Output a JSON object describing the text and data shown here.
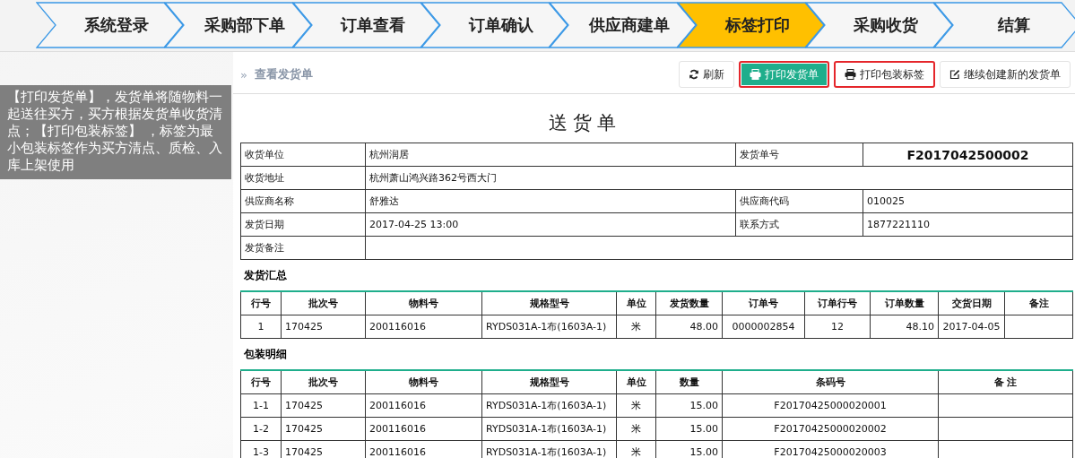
{
  "steps": [
    {
      "label": "系统登录",
      "selected": false
    },
    {
      "label": "采购部下单",
      "selected": false
    },
    {
      "label": "订单查看",
      "selected": false
    },
    {
      "label": "订单确认",
      "selected": false
    },
    {
      "label": "供应商建单",
      "selected": false
    },
    {
      "label": "标签打印",
      "selected": true
    },
    {
      "label": "采购收货",
      "selected": false
    },
    {
      "label": "结算",
      "selected": false
    }
  ],
  "note": "【打印发货单】，发货单将随物料一起送往买方，买方根据发货单收货清点；【打印包装标签】 ，标签为最小包装标签作为买方清点、质检、入库上架使用",
  "breadcrumb": {
    "icon": "»",
    "label": "查看发货单"
  },
  "toolbar": [
    {
      "label": "刷新",
      "kind": "default",
      "highlighted": false
    },
    {
      "label": "打印发货单",
      "kind": "primary",
      "highlighted": true
    },
    {
      "label": "打印包装标签",
      "kind": "default",
      "highlighted": true
    },
    {
      "label": "继续创建新的发货单",
      "kind": "default",
      "highlighted": false
    }
  ],
  "document": {
    "title": "送货单",
    "info_rows": [
      [
        {
          "label": "收货单位",
          "value": "杭州润居",
          "emphasis": false
        },
        {
          "label": "发货单号",
          "value": "F2017042500002",
          "emphasis": true
        }
      ],
      [
        {
          "label": "收货地址",
          "value": "杭州萧山鸿兴路362号西大门",
          "emphasis": false
        }
      ],
      [
        {
          "label": "供应商名称",
          "value": "舒雅达",
          "emphasis": false
        },
        {
          "label": "供应商代码",
          "value": "010025",
          "emphasis": false
        }
      ],
      [
        {
          "label": "发货日期",
          "value": "2017-04-25 13:00",
          "emphasis": false
        },
        {
          "label": "联系方式",
          "value": "1877221110",
          "emphasis": false
        }
      ],
      [
        {
          "label": "发货备注"
        }
      ]
    ],
    "sections": [
      {
        "title": "发货汇总",
        "columns": [
          "行号",
          "批次号",
          "物料号",
          "规格型号",
          "单位",
          "发货数量",
          "订单号",
          "订单行号",
          "订单数量",
          "交货日期",
          "备注"
        ],
        "rows": [
          [
            "1",
            "170425",
            "200116016",
            "RYDS031A-1布(1603A-1)",
            "米",
            "48.00",
            "0000002854",
            "12",
            "48.10",
            "2017-04-05"
          ]
        ]
      },
      {
        "title": "包装明细",
        "columns": [
          "行号",
          "批次号",
          "物料号",
          "规格型号",
          "单位",
          "数量",
          "条码号",
          "备 注"
        ],
        "rows": [
          [
            "1-1",
            "170425",
            "200116016",
            "RYDS031A-1布(1603A-1)",
            "米",
            "15.00",
            "F20170425000020001"
          ],
          [
            "1-2",
            "170425",
            "200116016",
            "RYDS031A-1布(1603A-1)",
            "米",
            "15.00",
            "F20170425000020002"
          ],
          [
            "1-3",
            "170425",
            "200116016",
            "RYDS031A-1布(1603A-1)",
            "米",
            "15.00",
            "F20170425000020003"
          ]
        ]
      }
    ]
  }
}
